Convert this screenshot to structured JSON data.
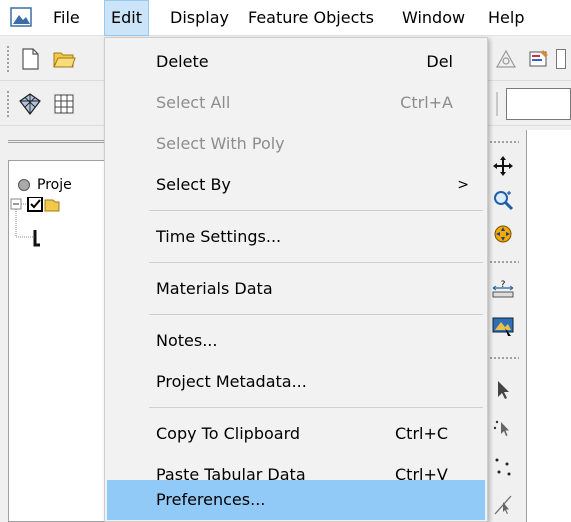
{
  "menubar": {
    "items": [
      {
        "label": "File"
      },
      {
        "label": "Edit",
        "active": true
      },
      {
        "label": "Display"
      },
      {
        "label": "Feature Objects"
      },
      {
        "label": "Window"
      },
      {
        "label": "Help"
      }
    ]
  },
  "edit_menu": {
    "items": [
      {
        "label": "Delete",
        "shortcut": "Del",
        "enabled": true
      },
      {
        "label": "Select All",
        "shortcut": "Ctrl+A",
        "enabled": false
      },
      {
        "label": "Select With Poly",
        "shortcut": "",
        "enabled": false
      },
      {
        "label": "Select By",
        "shortcut": "",
        "submenu_arrow": ">",
        "enabled": true
      },
      {
        "label": "Time Settings...",
        "shortcut": "",
        "enabled": true
      },
      {
        "label": "Materials Data",
        "shortcut": "",
        "enabled": true
      },
      {
        "label": "Notes...",
        "shortcut": "",
        "enabled": true
      },
      {
        "label": "Project Metadata...",
        "shortcut": "",
        "enabled": true
      },
      {
        "label": "Copy To Clipboard",
        "shortcut": "Ctrl+C",
        "enabled": true
      },
      {
        "label": "Paste Tabular Data",
        "shortcut": "Ctrl+V",
        "enabled": true
      },
      {
        "label": "Preferences...",
        "shortcut": "",
        "enabled": true,
        "highlighted": true
      }
    ]
  },
  "tree": {
    "root_label": "Proje"
  },
  "colors": {
    "highlight": "#91c9f7",
    "active_menu": "#cce4f7",
    "disabled_text": "#8d8d8d"
  }
}
